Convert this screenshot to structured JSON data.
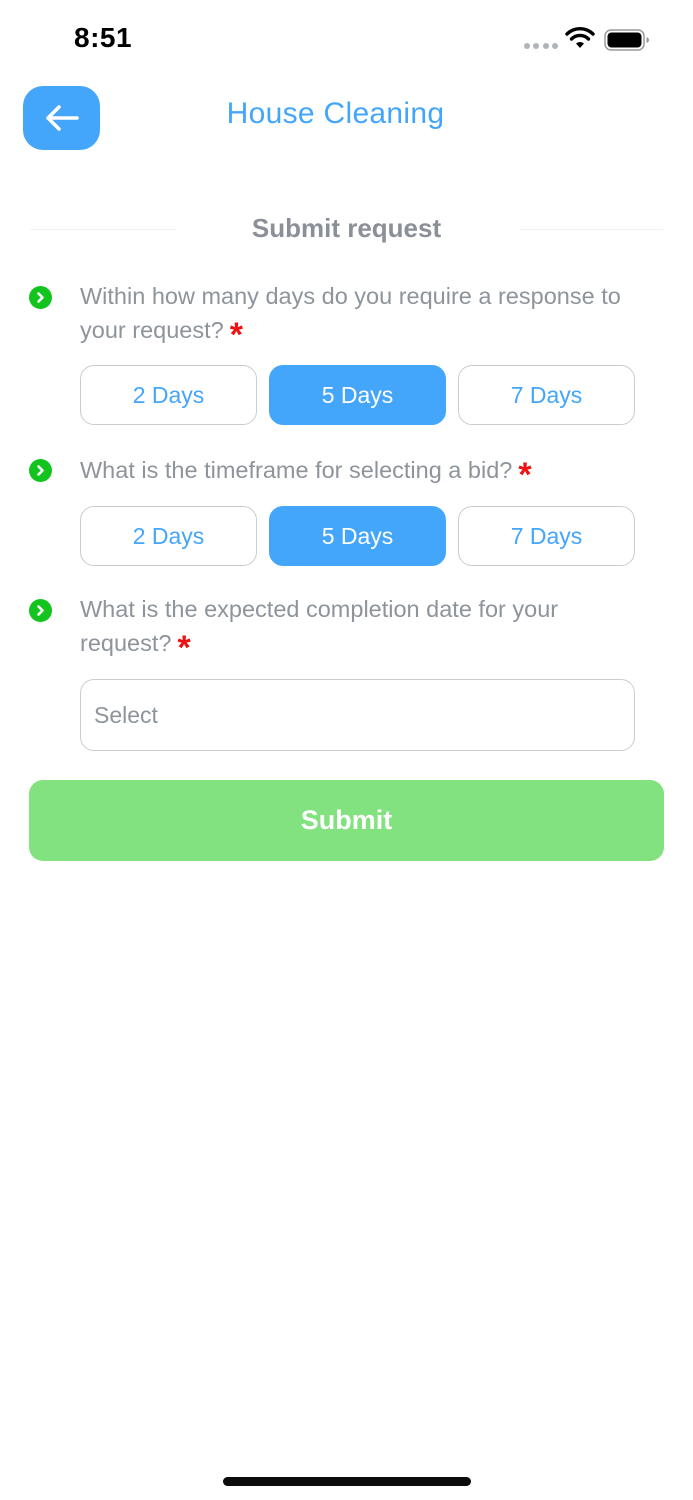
{
  "status_bar": {
    "time": "8:51"
  },
  "header": {
    "title": "House Cleaning",
    "back_icon": "arrow-left-icon"
  },
  "section": {
    "title": "Submit request"
  },
  "questions": [
    {
      "text": "Within how many days do you require a response to your request?",
      "required_mark": "*",
      "options": [
        "2 Days",
        "5 Days",
        "7 Days"
      ],
      "selected": "5 Days"
    },
    {
      "text": "What is the timeframe for selecting a bid?",
      "required_mark": "*",
      "options": [
        "2 Days",
        "5 Days",
        "7 Days"
      ],
      "selected": "5 Days"
    },
    {
      "text": "What is the expected completion date for your request?",
      "required_mark": "*",
      "placeholder": "Select"
    }
  ],
  "submit": {
    "label": "Submit"
  },
  "colors": {
    "accent": "#44a6fb",
    "success": "#81e27f",
    "required": "#ee1111",
    "bullet": "#14c41e"
  }
}
